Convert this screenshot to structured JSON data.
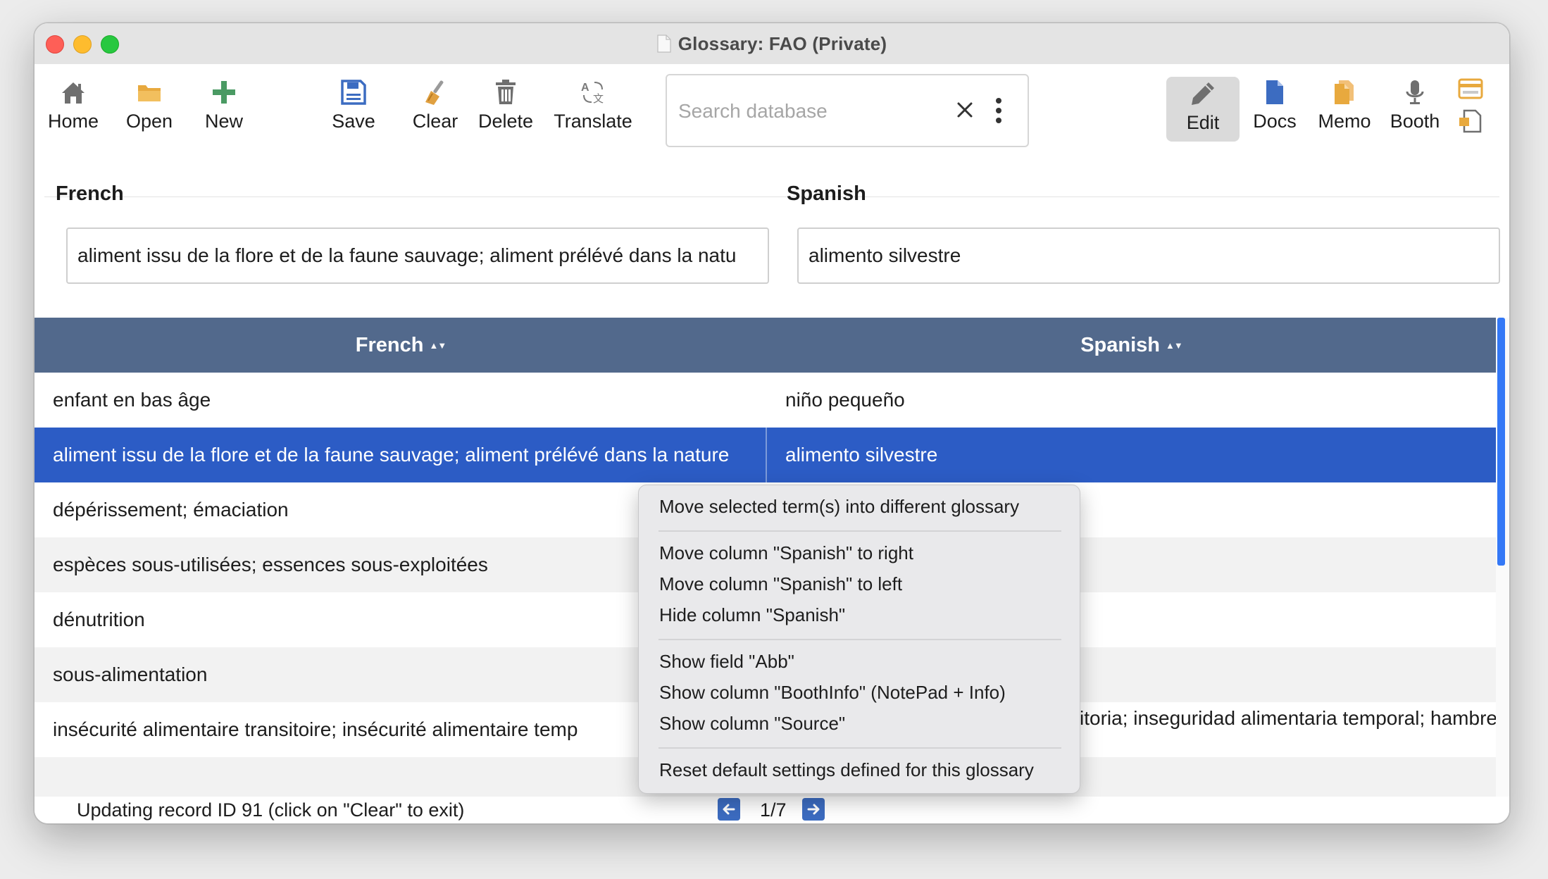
{
  "window": {
    "title": "Glossary: FAO  (Private)"
  },
  "toolbar": {
    "home": "Home",
    "open": "Open",
    "new": "New",
    "save": "Save",
    "clear": "Clear",
    "delete": "Delete",
    "translate": "Translate",
    "edit": "Edit",
    "docs": "Docs",
    "memo": "Memo",
    "booth": "Booth",
    "search_placeholder": "Search database",
    "search_value": ""
  },
  "fields": {
    "french_label": "French",
    "french_value": "aliment issu de la flore et de la faune sauvage; aliment prélévé dans la natu",
    "spanish_label": "Spanish",
    "spanish_value": "alimento silvestre"
  },
  "grid": {
    "columns": [
      "French",
      "Spanish"
    ],
    "rows": [
      {
        "french": "enfant en bas âge",
        "spanish": "niño pequeño"
      },
      {
        "french": "aliment issu de la flore et de la faune sauvage; aliment prélévé dans la nature",
        "spanish": "alimento silvestre"
      },
      {
        "french": "dépérissement; émaciation",
        "spanish": ""
      },
      {
        "french": "espèces sous-utilisées; essences sous-exploitées",
        "spanish": ""
      },
      {
        "french": "dénutrition",
        "spanish": ""
      },
      {
        "french": "sous-alimentation",
        "spanish": ""
      },
      {
        "french": "insécurité alimentaire transitoire; insécurité alimentaire temp",
        "spanish": "sitoria; inseguridad alimentaria temporal; hambre"
      }
    ],
    "selected_row": 2
  },
  "status": {
    "text": "Updating record ID 91 (click on \"Clear\" to exit)",
    "page": "1/7"
  },
  "context_menu": {
    "items": [
      "Move selected term(s) into different glossary",
      "Move column \"Spanish\" to right",
      "Move column \"Spanish\" to left",
      "Hide column \"Spanish\"",
      "Show field \"Abb\"",
      "Show column \"BoothInfo\" (NotePad + Info)",
      "Show column \"Source\"",
      "Reset default settings defined for this glossary"
    ]
  },
  "colors": {
    "header": "#52698c",
    "selection": "#2c5cc5",
    "accent": "#3478f6"
  }
}
